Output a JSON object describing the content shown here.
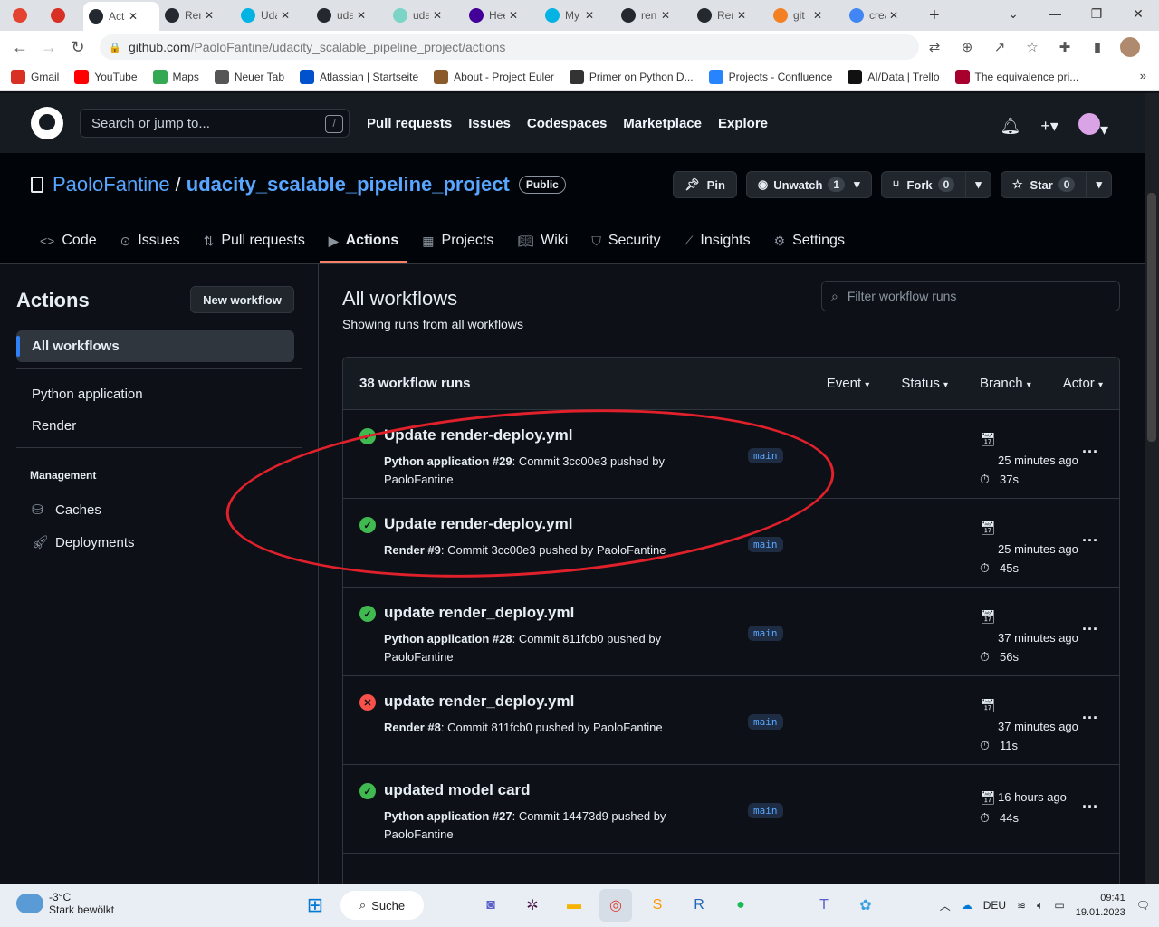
{
  "browser": {
    "tabs": [
      {
        "label": "",
        "icon": "todoist-icon",
        "color": "#e44332"
      },
      {
        "label": "",
        "icon": "gmail-icon",
        "color": "#d93025"
      },
      {
        "label": "Act",
        "icon": "github-icon",
        "color": "#24292f",
        "active": true
      },
      {
        "label": "Ren",
        "icon": "github-icon",
        "color": "#24292f"
      },
      {
        "label": "Uda",
        "icon": "udacity-icon",
        "color": "#02b3e4"
      },
      {
        "label": "uda",
        "icon": "github-icon",
        "color": "#24292f"
      },
      {
        "label": "uda",
        "icon": "page-icon",
        "color": "#7bd4c5"
      },
      {
        "label": "Hee",
        "icon": "heroku-icon",
        "color": "#430098"
      },
      {
        "label": "My",
        "icon": "udacity-icon",
        "color": "#02b3e4"
      },
      {
        "label": "ren",
        "icon": "github-icon",
        "color": "#24292f"
      },
      {
        "label": "Ren",
        "icon": "github-icon",
        "color": "#24292f"
      },
      {
        "label": "git",
        "icon": "stackoverflow-icon",
        "color": "#f48024"
      },
      {
        "label": "crea",
        "icon": "google-icon",
        "color": "#4285f4"
      }
    ],
    "url_domain": "github.com",
    "url_path": "/PaoloFantine/udacity_scalable_pipeline_project/actions",
    "bookmarks": [
      {
        "label": "Gmail",
        "color": "#d93025"
      },
      {
        "label": "YouTube",
        "color": "#ff0000"
      },
      {
        "label": "Maps",
        "color": "#34a853"
      },
      {
        "label": "Neuer Tab",
        "color": "#555555"
      },
      {
        "label": "Atlassian | Startseite",
        "color": "#0052cc"
      },
      {
        "label": "About - Project Euler",
        "color": "#8a5a2b"
      },
      {
        "label": "Primer on Python D...",
        "color": "#333333"
      },
      {
        "label": "Projects - Confluence",
        "color": "#2684ff"
      },
      {
        "label": "AI/Data | Trello",
        "color": "#111111"
      },
      {
        "label": "The equivalence pri...",
        "color": "#a8002c"
      }
    ]
  },
  "header": {
    "search_placeholder": "Search or jump to...",
    "search_key": "/",
    "nav": [
      "Pull requests",
      "Issues",
      "Codespaces",
      "Marketplace",
      "Explore"
    ]
  },
  "repo": {
    "owner": "PaoloFantine",
    "separator": "/",
    "name": "udacity_scalable_pipeline_project",
    "visibility": "Public",
    "pin_label": "Pin",
    "watch_label": "Unwatch",
    "watch_count": "1",
    "fork_label": "Fork",
    "fork_count": "0",
    "star_label": "Star",
    "star_count": "0",
    "tabs": [
      {
        "label": "Code",
        "icon": "code-icon"
      },
      {
        "label": "Issues",
        "icon": "issue-icon"
      },
      {
        "label": "Pull requests",
        "icon": "pull-request-icon"
      },
      {
        "label": "Actions",
        "icon": "play-icon",
        "active": true
      },
      {
        "label": "Projects",
        "icon": "table-icon"
      },
      {
        "label": "Wiki",
        "icon": "book-icon"
      },
      {
        "label": "Security",
        "icon": "shield-icon"
      },
      {
        "label": "Insights",
        "icon": "graph-icon"
      },
      {
        "label": "Settings",
        "icon": "gear-icon"
      }
    ]
  },
  "sidebar": {
    "title": "Actions",
    "new_workflow": "New workflow",
    "all_workflows": "All workflows",
    "workflows": [
      "Python application",
      "Render"
    ],
    "management_heading": "Management",
    "management_items": [
      "Caches",
      "Deployments"
    ]
  },
  "main": {
    "title": "All workflows",
    "subtitle": "Showing runs from all workflows",
    "filter_placeholder": "Filter workflow runs",
    "runs_count_label": "38 workflow runs",
    "filters": [
      "Event",
      "Status",
      "Branch",
      "Actor"
    ],
    "runs": [
      {
        "status": "success",
        "title": "Update render-deploy.yml",
        "workflow": "Python application #29",
        "meta": ": Commit 3cc00e3 pushed by PaoloFantine",
        "branch": "main",
        "when": "25 minutes ago",
        "duration": "37s"
      },
      {
        "status": "success",
        "title": "Update render-deploy.yml",
        "workflow": "Render #9",
        "meta": ": Commit 3cc00e3 pushed by PaoloFantine",
        "branch": "main",
        "when": "25 minutes ago",
        "duration": "45s"
      },
      {
        "status": "success",
        "title": "update render_deploy.yml",
        "workflow": "Python application #28",
        "meta": ": Commit 811fcb0 pushed by PaoloFantine",
        "branch": "main",
        "when": "37 minutes ago",
        "duration": "56s"
      },
      {
        "status": "failure",
        "title": "update render_deploy.yml",
        "workflow": "Render #8",
        "meta": ": Commit 811fcb0 pushed by PaoloFantine",
        "branch": "main",
        "when": "37 minutes ago",
        "duration": "11s"
      },
      {
        "status": "success",
        "title": "updated model card",
        "workflow": "Python application #27",
        "meta": ": Commit 14473d9 pushed by PaoloFantine",
        "branch": "main",
        "when": "16 hours ago",
        "duration": "44s"
      }
    ]
  },
  "taskbar": {
    "temperature": "-3°C",
    "weather": "Stark bewölkt",
    "search": "Suche",
    "language": "DEU",
    "time": "09:41",
    "date": "19.01.2023"
  },
  "colors": {
    "success": "#3fb950",
    "failure": "#f85149",
    "annotation": "#e0202a"
  }
}
